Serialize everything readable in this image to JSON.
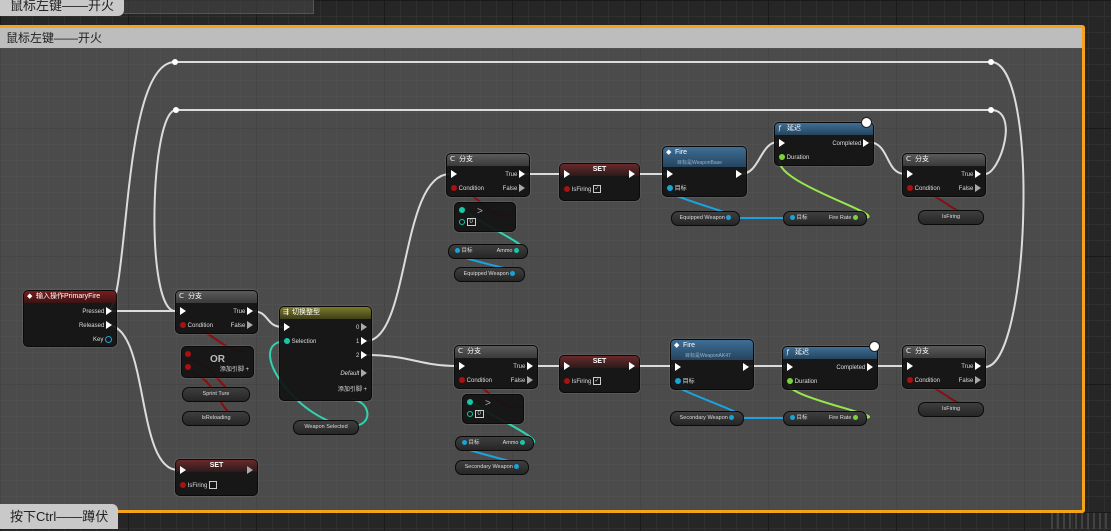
{
  "comments": {
    "top_label": "鼠标左键——开火",
    "main_title": "鼠标左键——开火",
    "bottom_label": "按下Ctrl——蹲伏"
  },
  "input_node": {
    "title": "输入操作PrimaryFire",
    "pins": [
      "Pressed",
      "Released",
      "Key"
    ]
  },
  "branch_main": {
    "title": "分支",
    "true": "True",
    "false": "False",
    "condition": "Condition"
  },
  "or_node": {
    "title": "OR",
    "add_pin": "添加引脚"
  },
  "sprint_pill": "Sprint Ture",
  "reloading_pill": "IsReloading",
  "set_bottom": {
    "title": "SET",
    "pin": "IsFiring"
  },
  "switch_node": {
    "title": "切换整型",
    "selection": "Selection",
    "outputs": [
      "0",
      "1",
      "2"
    ],
    "default": "Default",
    "add_pin": "添加引脚"
  },
  "weapon_selected": "Weapon Selected",
  "upper": {
    "branch1": {
      "title": "分支",
      "true": "True",
      "false": "False",
      "condition": "Condition"
    },
    "ammo_target": "目标",
    "ammo": "Ammo",
    "equipped_weapon": "Equipped Weapon",
    "set": {
      "title": "SET",
      "pin": "IsFiring"
    },
    "fire": {
      "title": "Fire",
      "subtitle": "目标是WeaponBase",
      "target": "目标"
    },
    "equipped_weapon2": "Equipped Weapon",
    "delay": {
      "title": "延迟",
      "completed": "Completed",
      "duration": "Duration"
    },
    "fire_rate_target": "目标",
    "fire_rate": "Fire Rate",
    "branch2": {
      "title": "分支",
      "true": "True",
      "false": "False",
      "condition": "Condition"
    },
    "isfiring": "IsFiring"
  },
  "lower": {
    "branch1": {
      "title": "分支",
      "true": "True",
      "false": "False",
      "condition": "Condition"
    },
    "ammo_target": "目标",
    "ammo": "Ammo",
    "secondary_weapon": "Secondary Weapon",
    "set": {
      "title": "SET",
      "pin": "IsFiring"
    },
    "fire": {
      "title": "Fire",
      "subtitle": "目标是WeaponAK47",
      "target": "目标"
    },
    "secondary_weapon2": "Secondary Weapon",
    "delay": {
      "title": "延迟",
      "completed": "Completed",
      "duration": "Duration"
    },
    "fire_rate_target": "目标",
    "fire_rate": "Fire Rate",
    "branch2": {
      "title": "分支",
      "true": "True",
      "false": "False",
      "condition": "Condition"
    },
    "isfiring": "IsFiring"
  },
  "colors": {
    "comment_border": "#f4a31b",
    "exec_wire": "#e8e8e8",
    "bool_wire": "#8f0f0f",
    "int_wire": "#2fd3b0",
    "object_wire": "#1aa3e0",
    "float_wire": "#96e84a"
  }
}
